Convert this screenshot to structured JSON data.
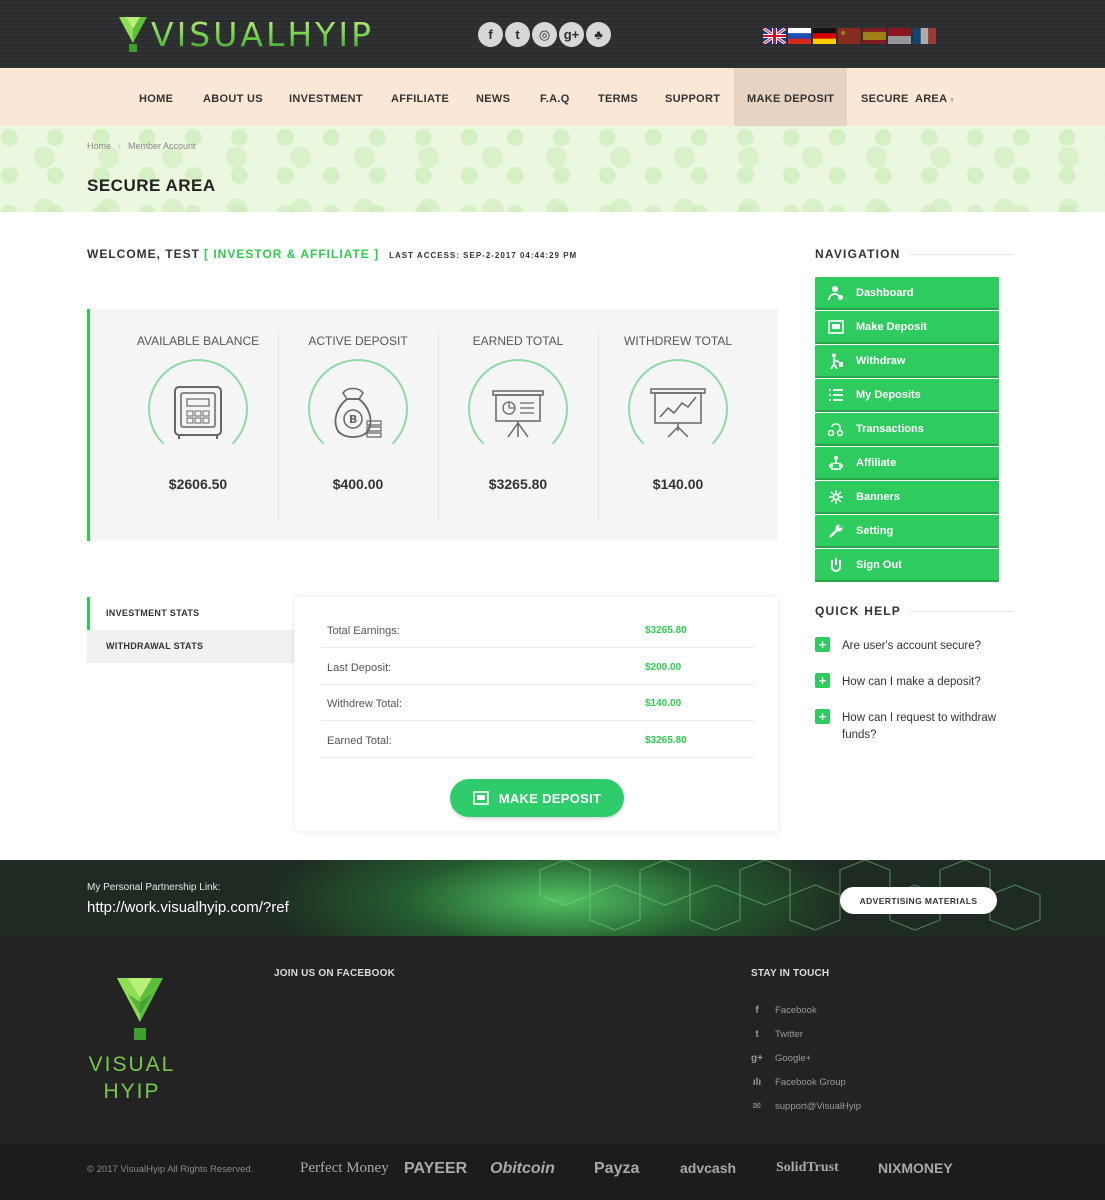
{
  "header": {
    "logo_text": "VISUALHYIP",
    "social": [
      {
        "icon": "facebook-icon",
        "glyph": "f"
      },
      {
        "icon": "twitter-icon",
        "glyph": "t"
      },
      {
        "icon": "instagram-icon",
        "glyph": "◎"
      },
      {
        "icon": "google-plus-icon",
        "glyph": "g+"
      },
      {
        "icon": "group-icon",
        "glyph": "♣"
      }
    ],
    "flags": [
      "en",
      "ru",
      "de",
      "cn",
      "es",
      "id",
      "fr"
    ]
  },
  "nav": {
    "items": [
      "HOME",
      "ABOUT US",
      "INVESTMENT",
      "AFFILIATE",
      "NEWS",
      "F.A.Q",
      "TERMS",
      "SUPPORT",
      "MAKE DEPOSIT",
      "SECURE  AREA"
    ],
    "active": "MAKE DEPOSIT",
    "dropdown_glyph": "▾"
  },
  "breadcrumb": {
    "home": "Home",
    "sep": "›",
    "current": "Member Account"
  },
  "page_title": "SECURE AREA",
  "welcome": {
    "text": "WELCOME, TEST",
    "role": "[ INVESTOR & AFFILIATE ]",
    "last_access": "LAST ACCESS: SEP-2-2017 04:44:29 PM"
  },
  "stats": [
    {
      "label": "AVAILABLE BALANCE",
      "value": "$2606.50",
      "icon": "safe-icon"
    },
    {
      "label": "ACTIVE DEPOSIT",
      "value": "$400.00",
      "icon": "bitcoin-bag-icon"
    },
    {
      "label": "EARNED TOTAL",
      "value": "$3265.80",
      "icon": "presentation-chart-icon"
    },
    {
      "label": "WITHDREW TOTAL",
      "value": "$140.00",
      "icon": "growth-board-icon"
    }
  ],
  "tabs": [
    "INVESTMENT STATS",
    "WITHDRAWAL STATS"
  ],
  "investment_stats": [
    {
      "label": "Total Earnings:",
      "value": "$3265.80"
    },
    {
      "label": "Last Deposit:",
      "value": "$200.00"
    },
    {
      "label": "Withdrew Total:",
      "value": "$140.00"
    },
    {
      "label": "Earned Total:",
      "value": "$3265.80"
    }
  ],
  "make_deposit_button": "MAKE DEPOSIT",
  "sidebar": {
    "navigation_title": "NAVIGATION",
    "items": [
      {
        "label": "Dashboard",
        "icon": "user-dashboard-icon"
      },
      {
        "label": "Make Deposit",
        "icon": "deposit-icon"
      },
      {
        "label": "Withdraw",
        "icon": "withdraw-icon"
      },
      {
        "label": "My Deposits",
        "icon": "list-icon"
      },
      {
        "label": "Transactions",
        "icon": "transactions-icon"
      },
      {
        "label": "Affiliate",
        "icon": "affiliate-icon"
      },
      {
        "label": "Banners",
        "icon": "banners-icon"
      },
      {
        "label": "Setting",
        "icon": "wrench-icon"
      },
      {
        "label": "Sign Out",
        "icon": "sign-out-icon"
      }
    ],
    "quick_help_title": "QUICK HELP",
    "quick_help": [
      "Are user's account secure?",
      "How can I make a deposit?",
      "How can I request to withdraw funds?"
    ],
    "plus_glyph": "+"
  },
  "partnership": {
    "label": "My Personal Partnership Link:",
    "link": "http://work.visualhyip.com/?ref",
    "button": "ADVERTISING MATERIALS"
  },
  "footer": {
    "logo_line1": "VISUAL",
    "logo_line2": "HYIP",
    "facebook_heading": "JOIN US ON FACEBOOK",
    "stay_heading": "STAY IN TOUCH",
    "links": [
      {
        "label": "Facebook",
        "icon": "facebook-square-icon",
        "glyph": "f"
      },
      {
        "label": "Twitter",
        "icon": "twitter-icon",
        "glyph": "t"
      },
      {
        "label": "Google+",
        "icon": "google-plus-icon",
        "glyph": "g+"
      },
      {
        "label": "Facebook Group",
        "icon": "group-icon",
        "glyph": "ılı"
      },
      {
        "label": "support@VisualHyip",
        "icon": "envelope-icon",
        "glyph": "✉"
      }
    ],
    "copyright": "© 2017 VisualHyip All Rights Reserved.",
    "payments": [
      "Perfect Money",
      "PAYEER",
      "Obitcoin",
      "Payza",
      "advcash",
      "SolidTrust",
      "NIXMONEY"
    ]
  }
}
